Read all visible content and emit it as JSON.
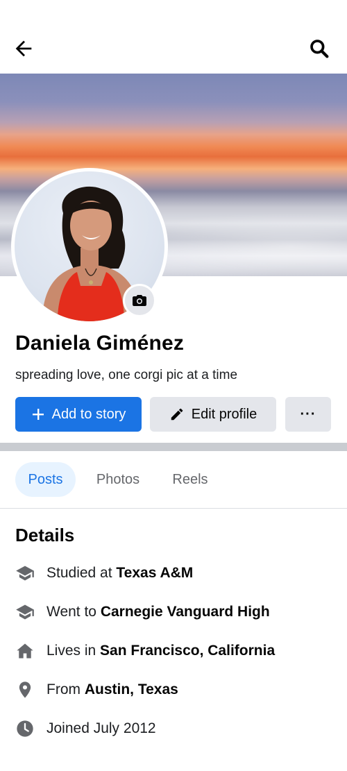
{
  "header": {
    "back_icon": "arrow-left-icon",
    "search_icon": "search-icon"
  },
  "profile": {
    "name": "Daniela Giménez",
    "bio": "spreading love, one corgi pic at a time",
    "camera_icon": "camera-icon"
  },
  "actions": {
    "add_to_story": "Add to story",
    "edit_profile": "Edit profile",
    "more": "···"
  },
  "tabs": [
    {
      "label": "Posts",
      "active": true
    },
    {
      "label": "Photos",
      "active": false
    },
    {
      "label": "Reels",
      "active": false
    }
  ],
  "details": {
    "title": "Details",
    "items": [
      {
        "icon": "graduation-cap-icon",
        "prefix": "Studied at ",
        "bold": "Texas A&M"
      },
      {
        "icon": "graduation-cap-icon",
        "prefix": "Went to ",
        "bold": "Carnegie Vanguard High"
      },
      {
        "icon": "home-icon",
        "prefix": "Lives in ",
        "bold": "San Francisco, California"
      },
      {
        "icon": "location-pin-icon",
        "prefix": "From ",
        "bold": "Austin, Texas"
      },
      {
        "icon": "clock-icon",
        "prefix": "Joined July 2012",
        "bold": ""
      }
    ]
  },
  "colors": {
    "primary": "#1b74e4",
    "secondary_button": "#e4e6eb",
    "active_tab_bg": "#e7f3ff",
    "icon_gray": "#65676b"
  }
}
